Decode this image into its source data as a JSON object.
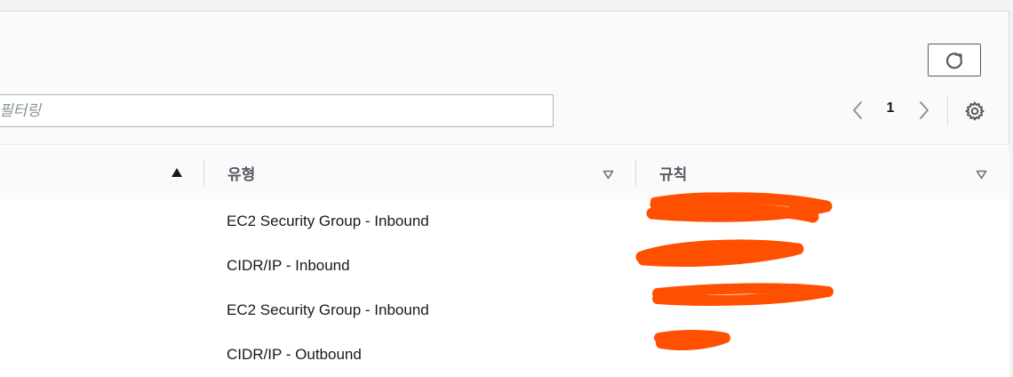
{
  "toolbar": {
    "refresh_icon": "refresh-icon",
    "filter_placeholder": "필터링",
    "pagination": {
      "current_page": "1",
      "prev_icon": "chevron-left-icon",
      "next_icon": "chevron-right-icon"
    },
    "settings_icon": "gear-icon"
  },
  "table": {
    "columns": [
      {
        "label": "",
        "sort": "ascending"
      },
      {
        "label": "유형",
        "sort": "none"
      },
      {
        "label": "규칙",
        "sort": "none"
      }
    ],
    "rows": [
      {
        "type": "EC2 Security Group - Inbound",
        "rule": ""
      },
      {
        "type": "CIDR/IP - Inbound",
        "rule": ""
      },
      {
        "type": "EC2 Security Group - Inbound",
        "rule": ""
      },
      {
        "type": "CIDR/IP - Outbound",
        "rule": ""
      }
    ]
  },
  "colors": {
    "redaction": "#ff4f00",
    "border": "#d5dbdb",
    "text": "#16191f",
    "muted": "#545b64"
  }
}
